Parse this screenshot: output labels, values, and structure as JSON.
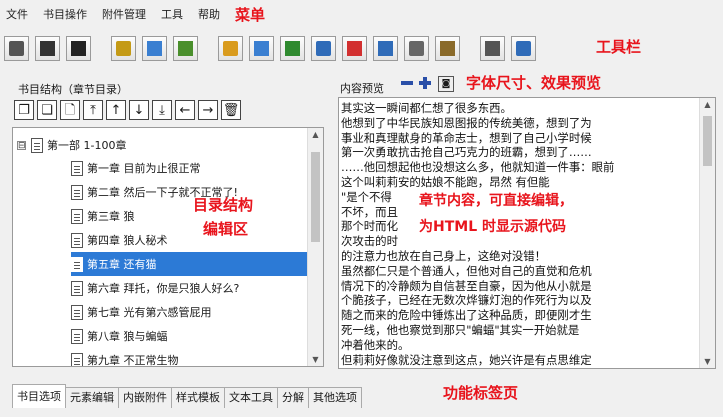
{
  "menu": {
    "items": [
      "文件",
      "书目操作",
      "附件管理",
      "工具",
      "帮助"
    ],
    "annotation": "菜单"
  },
  "toolbar": {
    "annotation": "工具栏",
    "buttons": [
      {
        "icon": "new-document-icon",
        "color": "#555555"
      },
      {
        "icon": "open-folder-icon",
        "color": "#333333"
      },
      {
        "icon": "save-icon",
        "color": "#222222"
      },
      {
        "icon": "book-properties-icon",
        "color": "#c49a16"
      },
      {
        "icon": "book-export-icon",
        "color": "#3a7fd1"
      },
      {
        "icon": "book-import-icon",
        "color": "#4a8f2c"
      },
      {
        "icon": "align-columns-icon",
        "color": "#d99b1d"
      },
      {
        "icon": "chart-bars-icon",
        "color": "#3a7fd1"
      },
      {
        "icon": "list-arrow-icon",
        "color": "#2f8a2f"
      },
      {
        "icon": "list-indent-icon",
        "color": "#2f6bb8"
      },
      {
        "icon": "align-center-icon",
        "color": "#d23030"
      },
      {
        "icon": "paragraph-format-icon",
        "color": "#2f6bb8"
      },
      {
        "icon": "text-style-icon",
        "color": "#666666"
      },
      {
        "icon": "image-insert-icon",
        "color": "#8a6a2a"
      },
      {
        "icon": "copy-pages-icon",
        "color": "#555555"
      },
      {
        "icon": "html-code-icon",
        "color": "#2f6bb8"
      }
    ]
  },
  "left_panel": {
    "title": "书目结构（章节目录）",
    "annotation_line1": "目录结构",
    "annotation_line2": "编辑区",
    "tree_buttons": [
      {
        "icon": "copy-icon",
        "glyph": "❐"
      },
      {
        "icon": "paste-icon",
        "glyph": "❏"
      },
      {
        "icon": "new-page-icon",
        "glyph": "🗋"
      },
      {
        "icon": "move-top-icon",
        "glyph": "⤒"
      },
      {
        "icon": "move-up-icon",
        "glyph": "↑"
      },
      {
        "icon": "move-down-icon",
        "glyph": "↓"
      },
      {
        "icon": "move-bottom-icon",
        "glyph": "⤓"
      },
      {
        "icon": "move-left-icon",
        "glyph": "←"
      },
      {
        "icon": "move-right-icon",
        "glyph": "→"
      },
      {
        "icon": "trash-icon",
        "glyph": "🗑"
      }
    ],
    "root": {
      "label": "第一部 1-100章",
      "expander": "⊟"
    },
    "chapters": [
      "第一章  目前为止很正常",
      "第二章  然后一下子就不正常了!",
      "第三章  狼",
      "第四章  狼人秘术",
      "第五章  还有猫",
      "第六章  拜托，你是只狼人好么?",
      "第七章  光有第六感管屁用",
      "第八章  狼与蝙蝠",
      "第九章  不正常生物"
    ],
    "selected_index": 4
  },
  "preview": {
    "title": "内容预览",
    "zoom_out": "−",
    "zoom_in": "+",
    "annotation": "字体尺寸、效果预览",
    "lines": [
      "其实这一瞬间都仁想了很多东西。",
      "他想到了中华民族知恩图报的传统美德，想到了为",
      "事业和真理献身的革命志士，想到了自己小学时候",
      "第一次勇敢抗击抢自己巧克力的班霸，想到了……",
      "……他回想起他也没想这么多，他就知道一件事：眼前",
      "这个叫莉莉安的姑娘不能跑，昂然              有但能",
      "\"是个不得",
      "不坏，而且",
      "那个时而化",
      "次攻击的时",
      "的注意力也放在自己身上，这绝对没错！",
      "虽然都仁只是个普通人，但他对自己的直觉和危机",
      "情况下的冷静颇为自信甚至自豪，因为他从小就是",
      "个脆孩子，已经在无数次烨镰灯泡的作死行为以及",
      "随之而来的危险中锤炼出了这种品质，即便刚才生",
      "死一线，他也察觉到那只\"蝙蝠\"其实一开始就是",
      "冲着他来的。",
      "但莉莉好像就没注意到这点，她兴许是有点思维定"
    ],
    "annotation_main": "章节内容，可直接编辑，",
    "annotation_html": "为HTML 时显示源代码"
  },
  "tabs": {
    "items": [
      "书目选项",
      "元素编辑",
      "内嵌附件",
      "样式模板",
      "文本工具",
      "分解",
      "其他选项"
    ],
    "active_index": 0,
    "annotation": "功能标签页"
  },
  "colors": {
    "annotation": "#e8141c",
    "selection": "#2c7ad6"
  }
}
